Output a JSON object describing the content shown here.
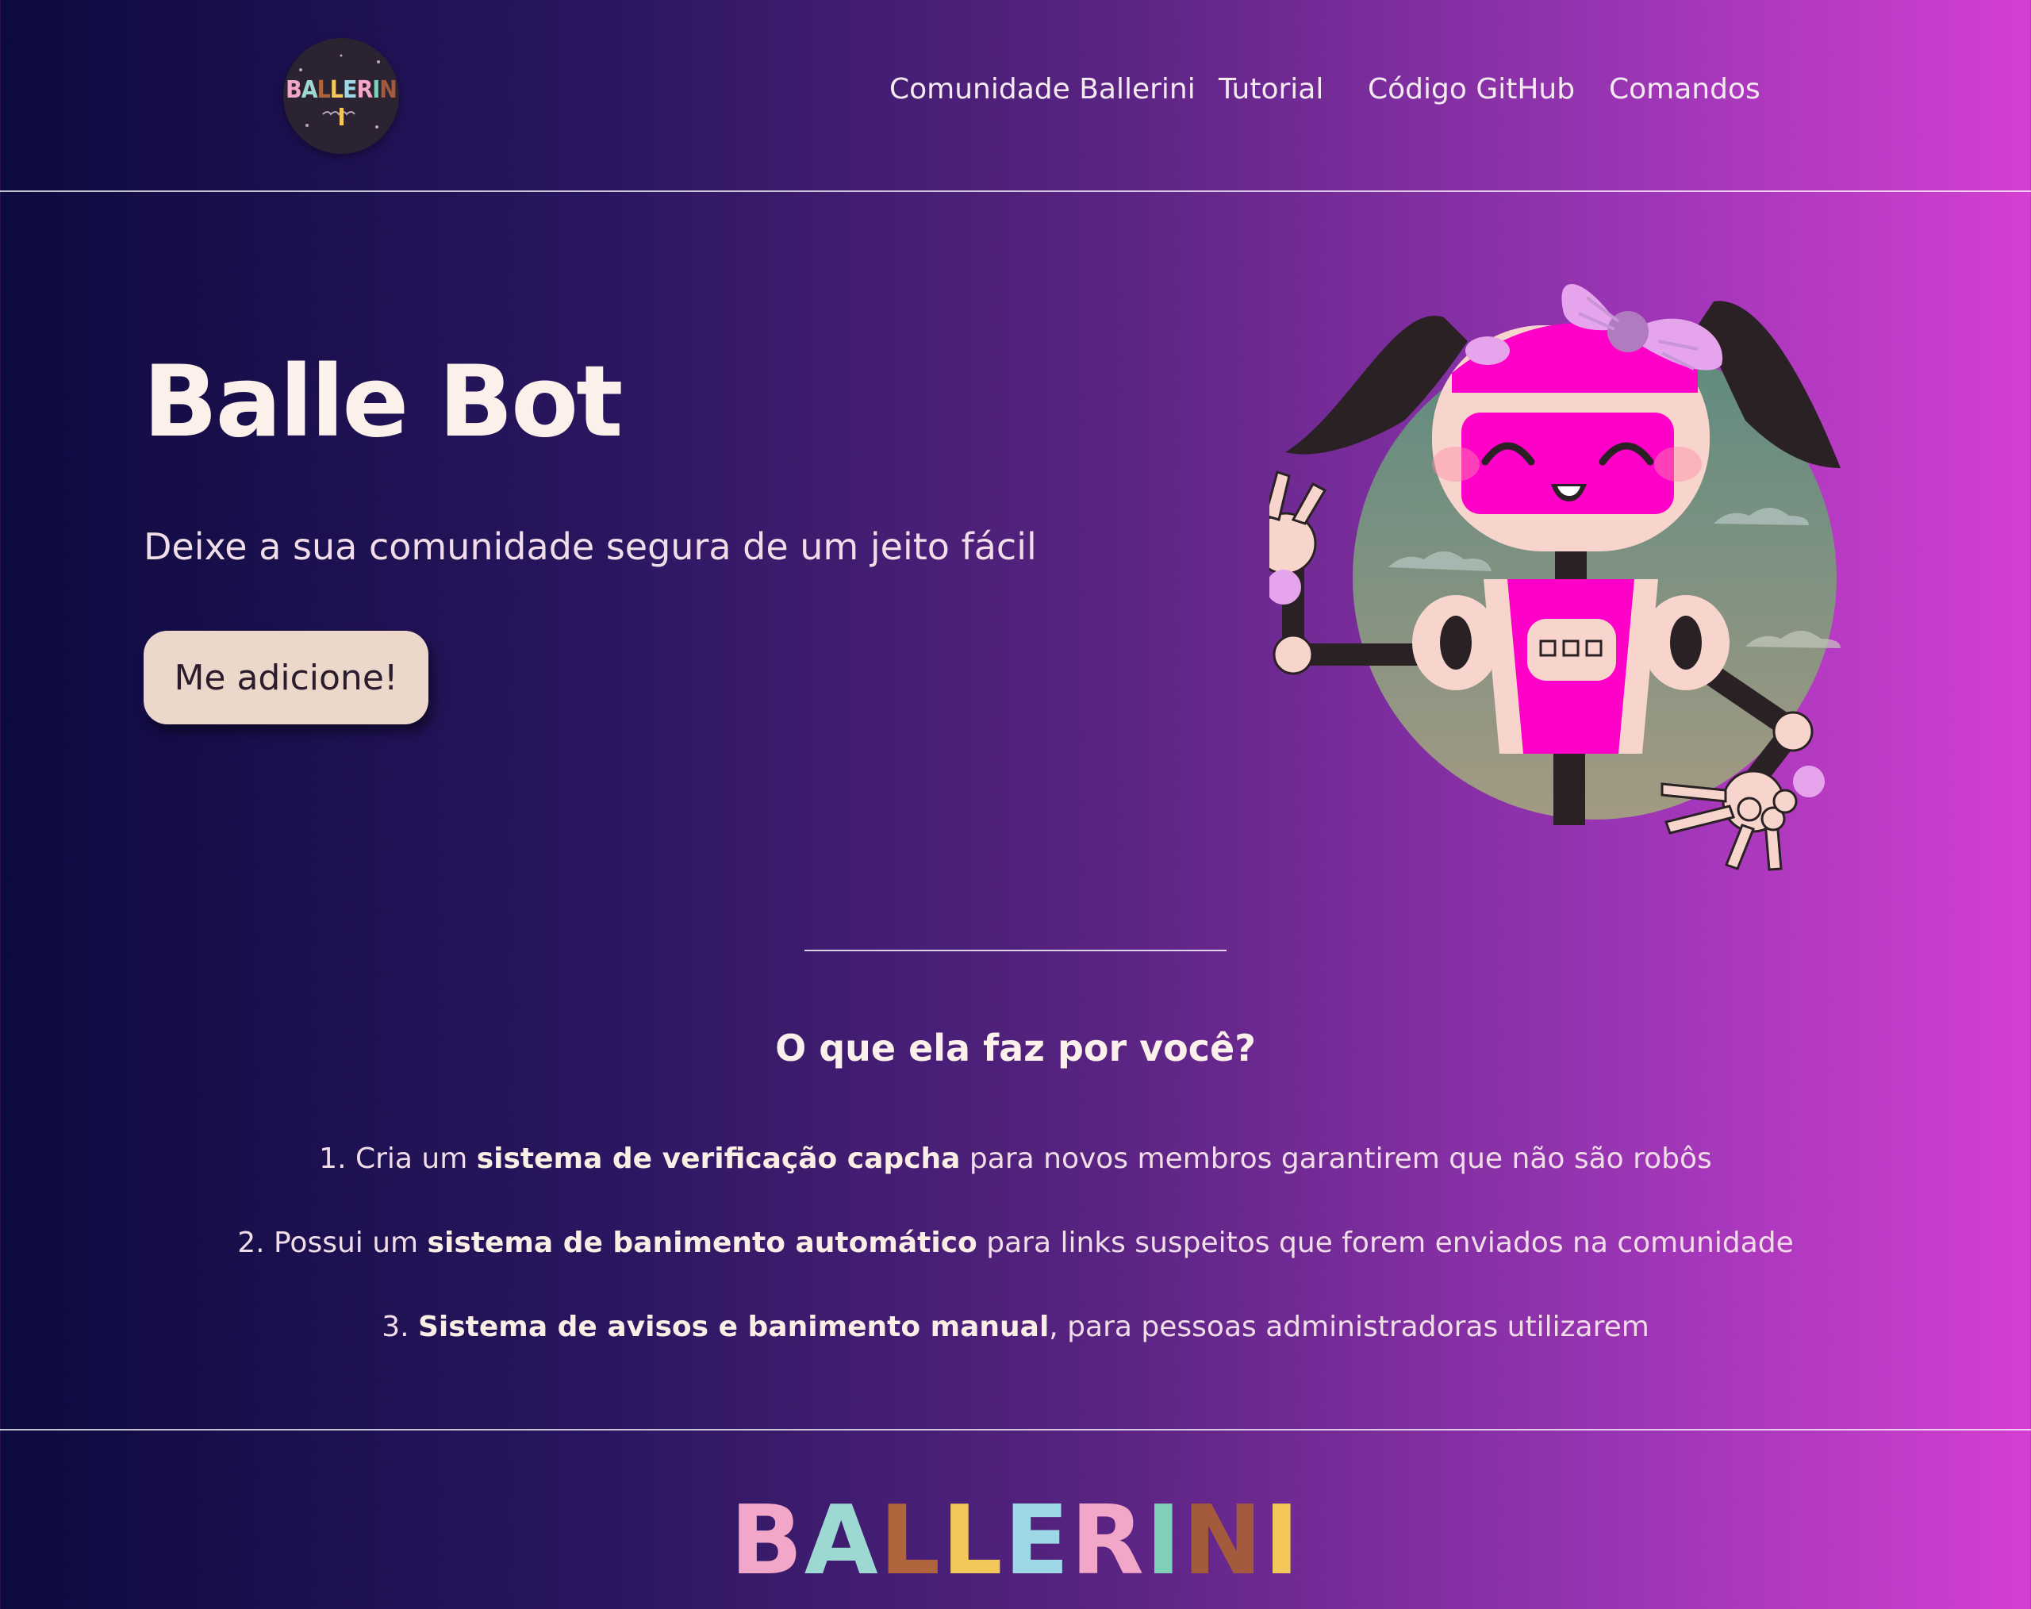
{
  "nav": {
    "logo_text": "BALLERINI",
    "links": [
      "Comunidade Ballerini",
      "Tutorial",
      "Código GitHub",
      "Comandos"
    ]
  },
  "hero": {
    "title": "Balle Bot",
    "subtitle": "Deixe a sua comunidade segura de um jeito fácil",
    "button_label": "Me adicione!"
  },
  "features": {
    "title": "O que ela faz por você?",
    "items": [
      {
        "prefix": "1. Cria um ",
        "bold": "sistema de verificação capcha",
        "suffix": " para novos membros garantirem que não são robôs"
      },
      {
        "prefix": "2. Possui um ",
        "bold": "sistema de banimento automático",
        "suffix": " para links suspeitos que forem enviados na comunidade"
      },
      {
        "prefix": "3. ",
        "bold": "Sistema de avisos e banimento manual",
        "suffix": ", para pessoas administradoras utilizarem"
      }
    ]
  },
  "footer": {
    "logo_letters": [
      "B",
      "A",
      "L",
      "L",
      "E",
      "R",
      "I",
      "N",
      "I"
    ]
  },
  "colors": {
    "gradient_start": "#0d0a3e",
    "gradient_end": "#d43fd2",
    "button_bg": "#ecd8cb",
    "robot_pink": "#ff00c8",
    "logo_letter_colors": [
      "#f2a6c8",
      "#9ed8d2",
      "#b0643c",
      "#f2c85a",
      "#9ed8e6",
      "#f2a6c8",
      "#7fd0b8",
      "#a45a3c",
      "#f2c85a"
    ]
  },
  "icons": [
    "ballerini-logo-icon",
    "robot-mascot-illustration"
  ]
}
